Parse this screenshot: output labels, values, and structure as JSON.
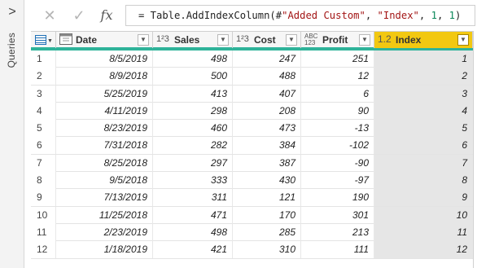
{
  "sidebar": {
    "chevron": ">",
    "label": "Queries"
  },
  "formula_bar": {
    "cancel_icon": "close-icon",
    "commit_icon": "check-icon",
    "fx_label": "fx",
    "prefix": "= Table.AddIndexColumn(#",
    "str1": "\"Added Custom\"",
    "sep1": ", ",
    "str2": "\"Index\"",
    "sep2": ", ",
    "n1": "1",
    "sep3": ", ",
    "n2": "1",
    "suffix": ")"
  },
  "columns": [
    {
      "type_icon": "calendar",
      "name": "Date"
    },
    {
      "type_icon": "1²3",
      "name": "Sales"
    },
    {
      "type_icon": "1²3",
      "name": "Cost"
    },
    {
      "type_icon": "ABC/123",
      "name": "Profit"
    },
    {
      "type_icon": "1.2",
      "name": "Index"
    }
  ],
  "rows": [
    {
      "n": "1",
      "date": "8/5/2019",
      "sales": "498",
      "cost": "247",
      "profit": "251",
      "index": "1"
    },
    {
      "n": "2",
      "date": "8/9/2018",
      "sales": "500",
      "cost": "488",
      "profit": "12",
      "index": "2"
    },
    {
      "n": "3",
      "date": "5/25/2019",
      "sales": "413",
      "cost": "407",
      "profit": "6",
      "index": "3"
    },
    {
      "n": "4",
      "date": "4/11/2019",
      "sales": "298",
      "cost": "208",
      "profit": "90",
      "index": "4"
    },
    {
      "n": "5",
      "date": "8/23/2019",
      "sales": "460",
      "cost": "473",
      "profit": "-13",
      "index": "5"
    },
    {
      "n": "6",
      "date": "7/31/2018",
      "sales": "282",
      "cost": "384",
      "profit": "-102",
      "index": "6"
    },
    {
      "n": "7",
      "date": "8/25/2018",
      "sales": "297",
      "cost": "387",
      "profit": "-90",
      "index": "7"
    },
    {
      "n": "8",
      "date": "9/5/2018",
      "sales": "333",
      "cost": "430",
      "profit": "-97",
      "index": "8"
    },
    {
      "n": "9",
      "date": "7/13/2019",
      "sales": "311",
      "cost": "121",
      "profit": "190",
      "index": "9"
    },
    {
      "n": "10",
      "date": "11/25/2018",
      "sales": "471",
      "cost": "170",
      "profit": "301",
      "index": "10"
    },
    {
      "n": "11",
      "date": "2/23/2019",
      "sales": "498",
      "cost": "285",
      "profit": "213",
      "index": "11"
    },
    {
      "n": "12",
      "date": "1/18/2019",
      "sales": "421",
      "cost": "310",
      "profit": "111",
      "index": "12"
    }
  ],
  "colors": {
    "accent": "#2fb39a",
    "selected_header": "#f2c811",
    "selected_column": "#e6e6e6"
  }
}
